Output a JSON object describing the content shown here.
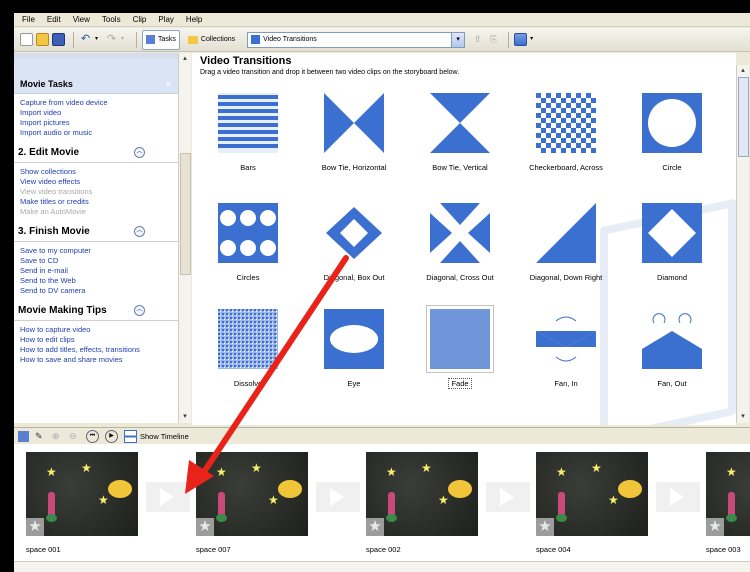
{
  "menu": [
    "File",
    "Edit",
    "View",
    "Tools",
    "Clip",
    "Play",
    "Help"
  ],
  "toolbar": {
    "tasks_label": "Tasks",
    "collections_label": "Collections",
    "collection_select": "Video Transitions"
  },
  "taskpane": {
    "header": "Movie Tasks",
    "capture_section_links": [
      "Capture from video device",
      "Import video",
      "Import pictures",
      "Import audio or music"
    ],
    "edit_title": "2. Edit Movie",
    "edit_links": [
      "Show collections",
      "View video effects",
      "View video transitions",
      "Make titles or credits",
      "Make an AutoMovie"
    ],
    "finish_title": "3. Finish Movie",
    "finish_links": [
      "Save to my computer",
      "Save to CD",
      "Send in e-mail",
      "Send to the Web",
      "Send to DV camera"
    ],
    "tips_title": "Movie Making Tips",
    "tips_links": [
      "How to capture video",
      "How to edit clips",
      "How to add titles, effects, transitions",
      "How to save and share movies"
    ]
  },
  "content": {
    "title": "Video Transitions",
    "subtitle": "Drag a video transition and drop it between two video clips on the storyboard below.",
    "transitions": [
      "Bars",
      "Bow Tie, Horizontal",
      "Bow Tie, Vertical",
      "Checkerboard, Across",
      "Circle",
      "Circles",
      "Diagonal, Box Out",
      "Diagonal, Cross Out",
      "Diagonal, Down Right",
      "Diamond",
      "Dissolve",
      "Eye",
      "Fade",
      "Fan, In",
      "Fan, Out"
    ],
    "selected_transition": "Fade"
  },
  "storyboard_toolbar": {
    "show_timeline_label": "Show Timeline"
  },
  "storyboard": {
    "clips": [
      "space 001",
      "space 007",
      "space 002",
      "space 004",
      "space 003"
    ]
  },
  "colors": {
    "transition_blue": "#3b6fd0",
    "link_blue": "#1e3fb0",
    "annotation_arrow": "#e8241a"
  }
}
